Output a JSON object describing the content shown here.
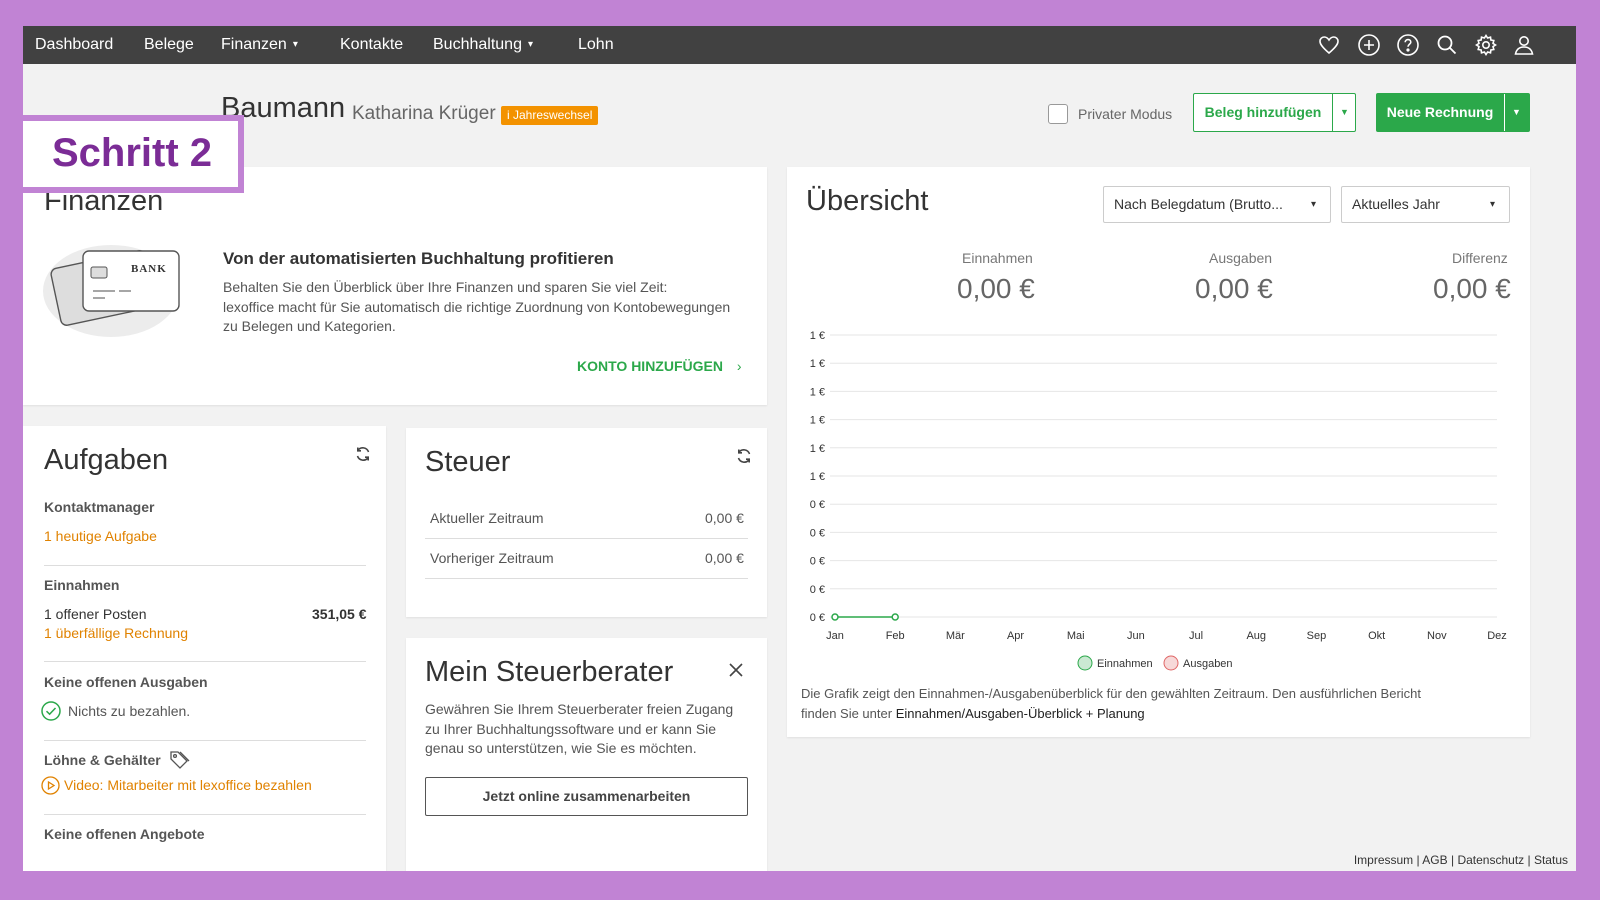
{
  "nav": {
    "items": [
      {
        "label": "Dashboard",
        "has_dropdown": false
      },
      {
        "label": "Belege",
        "has_dropdown": false
      },
      {
        "label": "Finanzen",
        "has_dropdown": true
      },
      {
        "label": "Kontakte",
        "has_dropdown": false
      },
      {
        "label": "Buchhaltung",
        "has_dropdown": true
      },
      {
        "label": "Lohn",
        "has_dropdown": false
      }
    ],
    "icons": [
      "heart-icon",
      "plus-circle-icon",
      "help-icon",
      "search-icon",
      "gear-icon",
      "user-icon"
    ]
  },
  "header": {
    "company": "Baumann",
    "user": "Katharina Krüger",
    "badge": "i Jahreswechsel",
    "private_mode_label": "Privater Modus",
    "private_mode_checked": false,
    "add_receipt_label": "Beleg hinzufügen",
    "new_invoice_label": "Neue Rechnung"
  },
  "overlay": {
    "step_label": "Schritt 2"
  },
  "finanzen": {
    "title": "Finanzen",
    "card_image_text": "BANK",
    "headline": "Von der automatisierten Buchhaltung profitieren",
    "body": [
      "Behalten Sie den Überblick über Ihre Finanzen und sparen Sie viel Zeit:",
      "lexoffice macht für Sie automatisch die richtige Zuordnung von Kontobewegungen",
      "zu Belegen und Kategorien."
    ],
    "cta": "KONTO HINZUFÜGEN"
  },
  "aufgaben": {
    "title": "Aufgaben",
    "kontaktmanager_label": "Kontaktmanager",
    "kontaktmanager_task": "1 heutige Aufgabe",
    "einnahmen_label": "Einnahmen",
    "einnahmen_open": "1  offener Posten",
    "einnahmen_amount": "351,05 €",
    "einnahmen_overdue": "1  überfällige Rechnung",
    "ausgaben_label": "Keine offenen Ausgaben",
    "ausgaben_text": "Nichts zu bezahlen.",
    "loehne_label": "Löhne & Gehälter",
    "loehne_video": "Video: Mitarbeiter mit lexoffice bezahlen",
    "angebote_label": "Keine offenen Angebote"
  },
  "steuer": {
    "title": "Steuer",
    "rows": [
      {
        "label": "Aktueller Zeitraum",
        "value": "0,00 €"
      },
      {
        "label": "Vorheriger Zeitraum",
        "value": "0,00 €"
      }
    ]
  },
  "steuerberater": {
    "title": "Mein Steuerberater",
    "body": [
      "Gewähren Sie Ihrem Steuerberater freien Zugang",
      "zu Ihrer Buchhaltungssoftware und er kann Sie",
      "genau so unterstützen, wie Sie es möchten."
    ],
    "button": "Jetzt online zusammenarbeiten"
  },
  "uebersicht": {
    "title": "Übersicht",
    "filter_date": "Nach Belegdatum (Brutto...",
    "filter_period": "Aktuelles Jahr",
    "stats": [
      {
        "label": "Einnahmen",
        "value": "0,00 €"
      },
      {
        "label": "Ausgaben",
        "value": "0,00 €"
      },
      {
        "label": "Differenz",
        "value": "0,00 €"
      }
    ],
    "note_prefix": "Die Grafik zeigt den Einnahmen-/Ausgabenüberblick für den gewählten Zeitraum. Den ausführlichen Bericht",
    "note_line2": "finden Sie unter ",
    "note_link": "Einnahmen/Ausgaben-Überblick + Planung"
  },
  "chart_data": {
    "type": "line",
    "x": [
      "Jan",
      "Feb",
      "Mär",
      "Apr",
      "Mai",
      "Jun",
      "Jul",
      "Aug",
      "Sep",
      "Okt",
      "Nov",
      "Dez"
    ],
    "y_tick_labels": [
      "1 €",
      "1 €",
      "1 €",
      "1 €",
      "1 €",
      "1 €",
      "0 €",
      "0 €",
      "0 €",
      "0 €",
      "0 €"
    ],
    "series": [
      {
        "name": "Einnahmen",
        "values": [
          0,
          0
        ],
        "color": "#2ba84a"
      },
      {
        "name": "Ausgaben",
        "values": [],
        "color": "#e06666"
      }
    ],
    "legend_position": "bottom-center",
    "grid": true
  },
  "footer": {
    "links": [
      "Impressum",
      "AGB",
      "Datenschutz",
      "Status"
    ]
  },
  "colors": {
    "accent_green": "#2ba84a",
    "orange": "#e08200",
    "badge_orange": "#f39200",
    "nav_bg": "#414141",
    "frame_purple": "#c183d4",
    "step_purple": "#7b2c96"
  }
}
